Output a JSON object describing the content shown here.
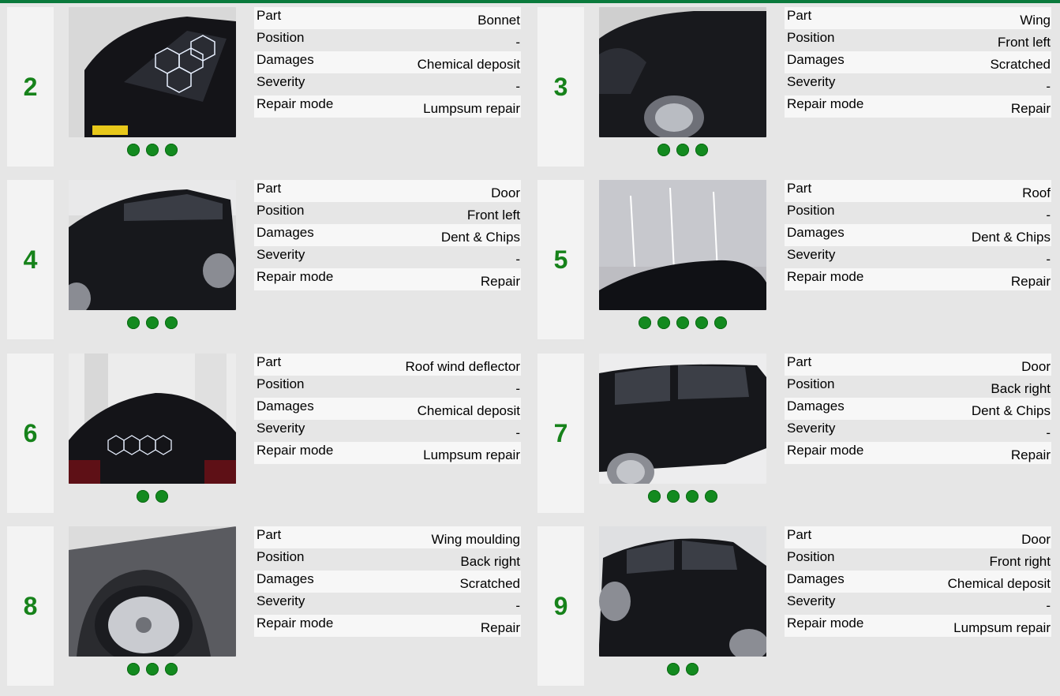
{
  "field_labels": {
    "part": "Part",
    "position": "Position",
    "damages": "Damages",
    "severity": "Severity",
    "repair_mode": "Repair mode"
  },
  "colors": {
    "accent": "#0a7a3c",
    "number": "#16821a",
    "dot": "#138a1f"
  },
  "cards": [
    {
      "number": "2",
      "part": "Bonnet",
      "position": "-",
      "damages": "Chemical deposit",
      "severity": "-",
      "repair_mode": "Lumpsum repair",
      "photo_count": 3,
      "photo": "car-bonnet-photo"
    },
    {
      "number": "3",
      "part": "Wing",
      "position": "Front left",
      "damages": "Scratched",
      "severity": "-",
      "repair_mode": "Repair",
      "photo_count": 3,
      "photo": "car-front-wing-photo"
    },
    {
      "number": "4",
      "part": "Door",
      "position": "Front left",
      "damages": "Dent & Chips",
      "severity": "-",
      "repair_mode": "Repair",
      "photo_count": 3,
      "photo": "car-door-photo"
    },
    {
      "number": "5",
      "part": "Roof",
      "position": "-",
      "damages": "Dent & Chips",
      "severity": "-",
      "repair_mode": "Repair",
      "photo_count": 5,
      "photo": "car-roof-photo"
    },
    {
      "number": "6",
      "part": "Roof wind deflector",
      "position": "-",
      "damages": "Chemical deposit",
      "severity": "-",
      "repair_mode": "Lumpsum repair",
      "photo_count": 2,
      "photo": "car-rear-photo"
    },
    {
      "number": "7",
      "part": "Door",
      "position": "Back right",
      "damages": "Dent & Chips",
      "severity": "-",
      "repair_mode": "Repair",
      "photo_count": 4,
      "photo": "car-back-door-photo"
    },
    {
      "number": "8",
      "part": "Wing moulding",
      "position": "Back right",
      "damages": "Scratched",
      "severity": "-",
      "repair_mode": "Repair",
      "photo_count": 3,
      "photo": "car-wheel-arch-photo"
    },
    {
      "number": "9",
      "part": "Door",
      "position": "Front right",
      "damages": "Chemical deposit",
      "severity": "-",
      "repair_mode": "Lumpsum repair",
      "photo_count": 2,
      "photo": "car-side-photo"
    }
  ]
}
